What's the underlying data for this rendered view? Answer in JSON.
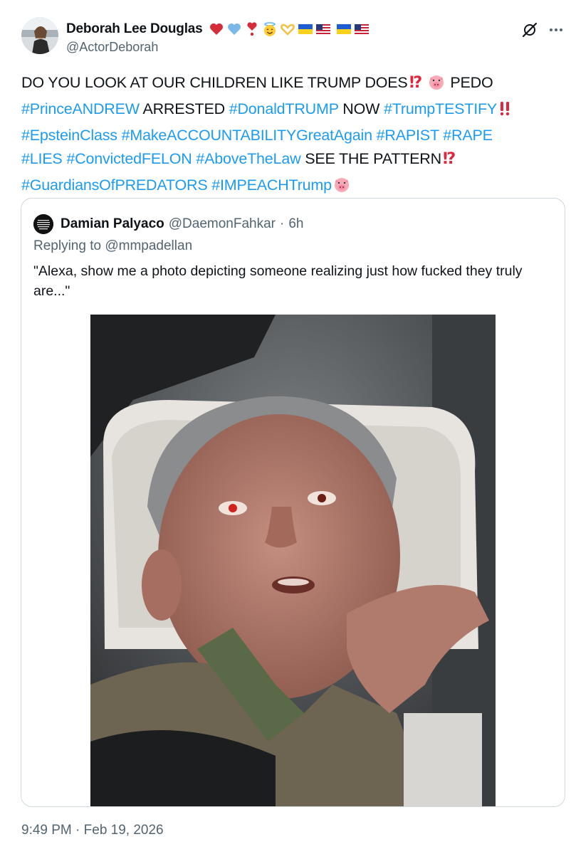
{
  "author": {
    "display_name": "Deborah Lee Douglas",
    "handle": "@ActorDeborah",
    "badge_emojis": [
      "red-heart",
      "light-blue-heart",
      "heart-exclamation",
      "smiling-face-with-halo",
      "heart-hands",
      "flag-ukraine",
      "flag-usa",
      "flag-ukraine",
      "flag-usa"
    ]
  },
  "actions": {
    "grok_icon": "grok-icon",
    "more_icon": "more-icon"
  },
  "tweet": {
    "line1": {
      "t1": "DO YOU LOOK AT OUR CHILDREN LIKE TRUMP DOES",
      "t2": "PEDO"
    },
    "line2": {
      "h1": "#PrinceANDREW",
      "t1": "ARRESTED",
      "h2": "#DonaldTRUMP",
      "t2": "NOW",
      "h3": "#TrumpTESTIFY"
    },
    "line3": {
      "h1": "#EpsteinClass",
      "h2": "#MakeACCOUNTABILITYGreatAgain",
      "h3": "#RAPIST",
      "h4": "#RAPE"
    },
    "line4": {
      "h1": "#LIES",
      "h2": "#ConvictedFELON",
      "h3": "#AboveTheLaw",
      "t1": "SEE THE PATTERN"
    },
    "line5": {
      "h1": "#GuardiansOfPREDATORS",
      "h2": "#IMPEACHTrump"
    }
  },
  "quoted_tweet": {
    "display_name": "Damian Palyaco",
    "handle": "@DaemonFahkar",
    "separator": "·",
    "time": "6h",
    "replying_to_label": "Replying to",
    "replying_to_handle": "@mmpadellan",
    "text": "\"Alexa, show me a photo depicting someone realizing just how fucked they truly are...\""
  },
  "timestamp": "9:49 PM · Feb 19, 2026",
  "colors": {
    "link": "#1d9bf0",
    "secondary_text": "#536471",
    "primary_text": "#0f1419",
    "border": "#cfd9de"
  }
}
